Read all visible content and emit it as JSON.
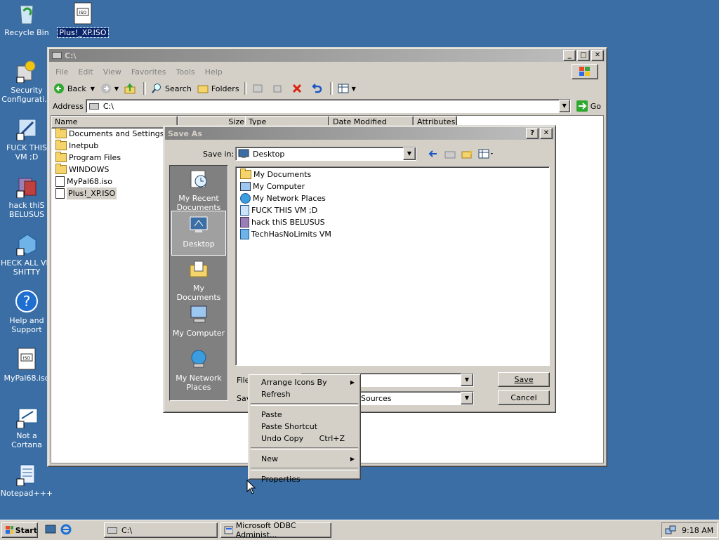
{
  "desktop": {
    "icons": [
      {
        "label": "Recycle Bin"
      },
      {
        "label": "Plus!_XP.ISO"
      },
      {
        "label": "Security Configurati..."
      },
      {
        "label": "FUCK THIS VM ;D"
      },
      {
        "label": "hack thiS BELUSUS"
      },
      {
        "label": "HECK ALL VM SHITTY"
      },
      {
        "label": "Help and Support"
      },
      {
        "label": "MyPal68.iso"
      },
      {
        "label": "Not a Cortana"
      },
      {
        "label": "Notepad+++"
      }
    ]
  },
  "explorer": {
    "title": "C:\\",
    "menu": [
      "File",
      "Edit",
      "View",
      "Favorites",
      "Tools",
      "Help"
    ],
    "toolbar": {
      "back": "Back",
      "search": "Search",
      "folders": "Folders"
    },
    "address_label": "Address",
    "address_value": "C:\\",
    "go_label": "Go",
    "columns": [
      "Name",
      "Size",
      "Type",
      "Date Modified",
      "Attributes"
    ],
    "files": [
      {
        "name": "Documents and Settings",
        "kind": "folder"
      },
      {
        "name": "Inetpub",
        "kind": "folder"
      },
      {
        "name": "Program Files",
        "kind": "folder"
      },
      {
        "name": "WINDOWS",
        "kind": "folder"
      },
      {
        "name": "MyPal68.iso",
        "kind": "iso"
      },
      {
        "name": "Plus!_XP.ISO",
        "kind": "iso"
      }
    ]
  },
  "dialog": {
    "title": "Save As",
    "save_in_label": "Save in:",
    "save_in_value": "Desktop",
    "places": [
      {
        "label": "My Recent Documents"
      },
      {
        "label": "Desktop"
      },
      {
        "label": "My Documents"
      },
      {
        "label": "My Computer"
      },
      {
        "label": "My Network Places"
      }
    ],
    "items": [
      "My Documents",
      "My Computer",
      "My Network Places",
      "FUCK THIS VM ;D",
      "hack thiS BELUSUS",
      "TechHasNoLimits VM"
    ],
    "file_name_label": "File",
    "save_as_type_label": "Sav",
    "save_as_type_value": "Sources",
    "save_button": "Save",
    "cancel_button": "Cancel"
  },
  "context_menu": {
    "items": [
      {
        "label": "Arrange Icons By",
        "submenu": true
      },
      {
        "label": "Refresh"
      },
      {
        "label": "Paste"
      },
      {
        "label": "Paste Shortcut"
      },
      {
        "label": "Undo Copy",
        "shortcut": "Ctrl+Z"
      },
      {
        "label": "New",
        "submenu": true
      },
      {
        "label": "Properties"
      }
    ]
  },
  "taskbar": {
    "start_label": "Start",
    "tasks": [
      "C:\\",
      "Microsoft ODBC Administ..."
    ],
    "clock": "9:18 AM"
  },
  "colors": {
    "desktop": "#3a6ea5",
    "titlebar_active": "#0a246a",
    "titlebar_inactive": "#808080",
    "face": "#d4d0c8"
  }
}
